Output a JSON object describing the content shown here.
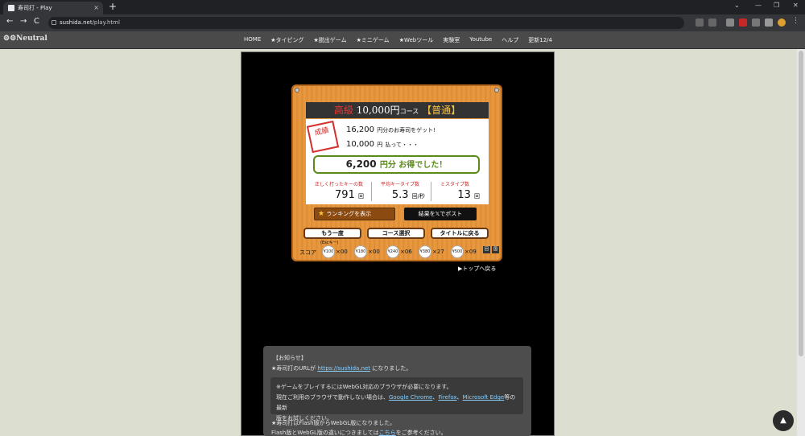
{
  "browser": {
    "tab_title": "寿司打 - Play",
    "tab_close": "×",
    "new_tab": "+",
    "win_min": "⌄",
    "win_minimize": "—",
    "win_restore": "❐",
    "win_close": "✕",
    "back": "←",
    "forward": "→",
    "reload": "C",
    "url_host": "sushida.net",
    "url_path": "/play.html"
  },
  "site": {
    "logo": "⚙⚙Neutral",
    "nav": [
      "HOME",
      "★タイピング",
      "★脱出ゲーム",
      "★ミニゲーム",
      "★Webツール",
      "実験室",
      "Youtube",
      "ヘルプ",
      "更新12/4"
    ]
  },
  "game": {
    "grade": "高級",
    "amount": "10,000円",
    "course": "コース",
    "level": "【普通】",
    "stamp": "成績",
    "earned_value": "16,200",
    "earned_text": "円分のお寿司をゲット!",
    "paid_value": "10,000",
    "paid_unit": "円",
    "paid_text": "払って・・・",
    "saved_value": "6,200",
    "saved_text": "円分 お得でした！",
    "stats": [
      {
        "label": "正しく打ったキーの数",
        "value": "791",
        "unit": "回"
      },
      {
        "label": "平均キータイプ数",
        "value": "5.3",
        "unit": "回/秒"
      },
      {
        "label": "ミスタイプ数",
        "value": "13",
        "unit": "回"
      }
    ],
    "rank_button": "ランキングを表示",
    "rank_star": "★",
    "post_button": "結果を𝕏でポスト",
    "retry_button": "もう一度",
    "esc_hint": "(Escキー)",
    "course_button": "コース選択",
    "title_button": "タイトルに戻る",
    "score_label": "スコア",
    "plates": [
      {
        "price": "¥100",
        "count": "×00"
      },
      {
        "price": "¥180",
        "count": "×00"
      },
      {
        "price": "¥240",
        "count": "×06"
      },
      {
        "price": "¥380",
        "count": "×27"
      },
      {
        "price": "¥500",
        "count": "×09"
      }
    ],
    "icon1": "回",
    "icon2": "国"
  },
  "top_link": "▶トップへ戻る",
  "notice": {
    "header": "【お知らせ】",
    "url_change": "★寿司打のURLが",
    "url_link": "https://sushida.net",
    "url_change_end": "になりました。",
    "webgl_line1": "※ゲームをプレイするにはWebGL対応のブラウザが必要になります。",
    "webgl_line2_a": "現在ご利用のブラウザで動作しない場合は、",
    "chrome": "Google Chrome",
    "firefox": "Firefox",
    "edge": "Microsoft Edge",
    "webgl_line2_b": "等の最新",
    "webgl_line3": "版をお試しください。",
    "flash_line": "★寿司打はFlash版からWebGL版になりました。",
    "flash_line2_a": "Flash版とWebGL版の違いにつきましては",
    "flash_link": "こちら",
    "flash_line2_b": "をご参考ください。"
  },
  "fab": "▲"
}
